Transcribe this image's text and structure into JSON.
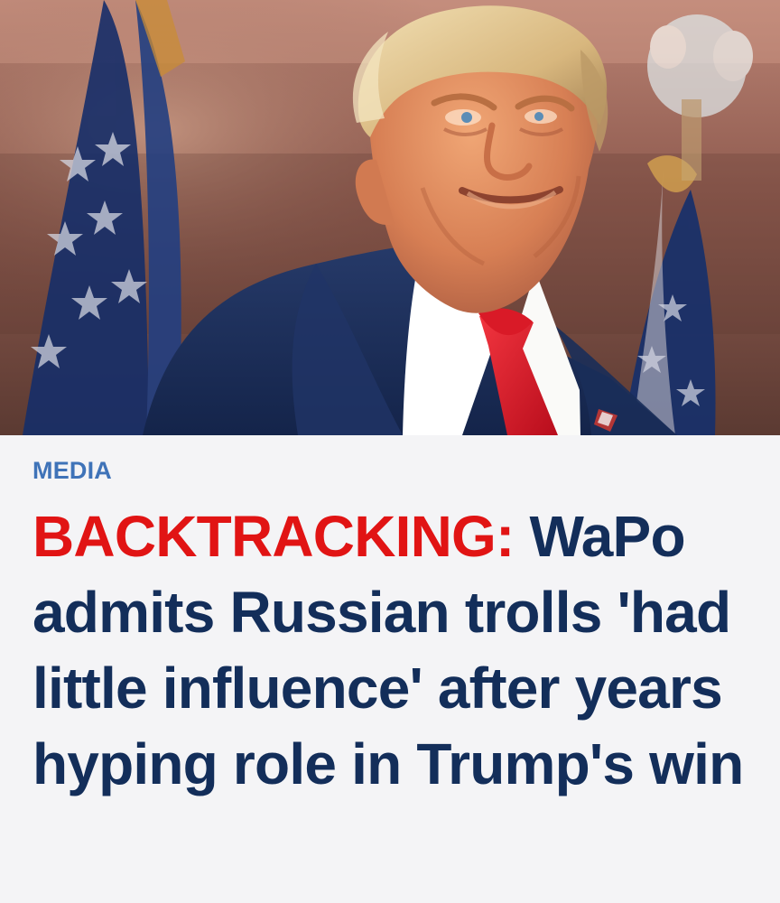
{
  "hero": {
    "image_alt": "Trump smiling in front of American flags"
  },
  "article": {
    "category": "MEDIA",
    "headline_kicker": "BACKTRACKING:",
    "headline_text": "WaPo admits Russian trolls 'had little influence' after years hyping role in Trump's win"
  },
  "colors": {
    "category": "#3f73b8",
    "kicker": "#e11414",
    "headline": "#132e5a",
    "background": "#f4f4f6"
  }
}
